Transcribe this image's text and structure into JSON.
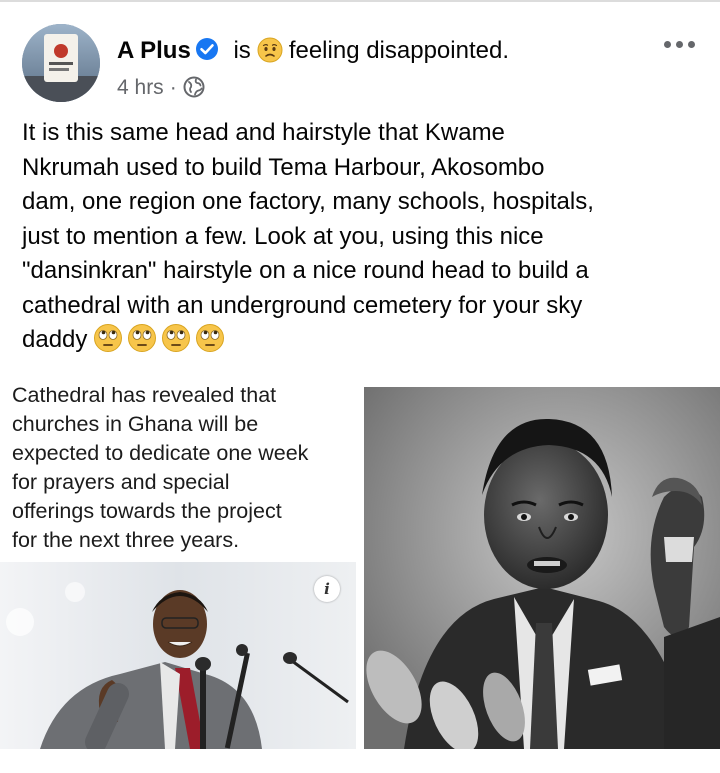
{
  "post": {
    "author": "A Plus",
    "verb": "is",
    "feeling": "feeling disappointed.",
    "time": "4 hrs",
    "separator": "·",
    "text": "It is this same head and hairstyle that Kwame\nNkrumah used to build Tema Harbour, Akosombo\ndam, one region one factory, many schools, hospitals,\njust to mention a few. Look at you, using this nice\n\"dansinkran\" hairstyle on a nice round head to build a\ncathedral with an underground cemetery for your sky\ndaddy"
  },
  "icons": {
    "verified": "verified-badge-icon",
    "feeling": "disappointed-face-icon",
    "audience": "globe-icon",
    "menu": "more-options-icon",
    "text_emoji": "face-with-rolling-eyes-icon"
  },
  "photos": {
    "left": {
      "article_text": "Cathedral has revealed that\nchurches in Ghana will be\nexpected to dedicate one week\nfor prayers and special\nofferings towards the project\nfor the next three years.",
      "info_label": "i"
    }
  },
  "colors": {
    "verified_blue": "#1877f2",
    "meta_gray": "#65676b"
  }
}
